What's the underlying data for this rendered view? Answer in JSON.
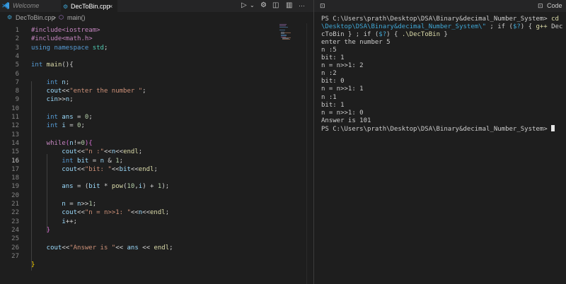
{
  "tabs": {
    "welcome": "Welcome",
    "active": "DecToBin.cpp",
    "close_symbol": "×"
  },
  "breadcrumb": {
    "file": "DecToBin.cpp",
    "separator": ">",
    "function": "main()"
  },
  "terminal_tab": {
    "label": "Code"
  },
  "editor": {
    "line_numbers": [
      "1",
      "2",
      "3",
      "4",
      "5",
      "6",
      "7",
      "8",
      "9",
      "10",
      "11",
      "12",
      "13",
      "14",
      "15",
      "16",
      "17",
      "18",
      "19",
      "20",
      "21",
      "22",
      "23",
      "24",
      "25",
      "26",
      "27"
    ],
    "active_line": 16,
    "lines": [
      [
        {
          "t": "#include<iostream>",
          "c": "#c586c0"
        }
      ],
      [
        {
          "t": "#include<math.h>",
          "c": "#c586c0"
        }
      ],
      [
        {
          "t": "using",
          "c": "#569cd6"
        },
        {
          "t": " namespace ",
          "c": "#569cd6"
        },
        {
          "t": "std",
          "c": "#4ec9b0"
        },
        {
          "t": ";",
          "c": "#d4d4d4"
        }
      ],
      [],
      [
        {
          "t": "int",
          "c": "#569cd6"
        },
        {
          "t": " main",
          "c": "#dcdcaa"
        },
        {
          "t": "(){",
          "c": "#d4d4d4"
        }
      ],
      [],
      [
        {
          "t": "    int",
          "c": "#569cd6"
        },
        {
          "t": " n",
          "c": "#9cdcfe"
        },
        {
          "t": ";",
          "c": "#d4d4d4"
        }
      ],
      [
        {
          "t": "    cout",
          "c": "#9cdcfe"
        },
        {
          "t": "<<",
          "c": "#d4d4d4"
        },
        {
          "t": "\"enter the number \"",
          "c": "#ce9178"
        },
        {
          "t": ";",
          "c": "#d4d4d4"
        }
      ],
      [
        {
          "t": "    cin",
          "c": "#9cdcfe"
        },
        {
          "t": ">>",
          "c": "#d4d4d4"
        },
        {
          "t": "n",
          "c": "#9cdcfe"
        },
        {
          "t": ";",
          "c": "#d4d4d4"
        }
      ],
      [],
      [
        {
          "t": "    int",
          "c": "#569cd6"
        },
        {
          "t": " ans",
          "c": "#9cdcfe"
        },
        {
          "t": " = ",
          "c": "#d4d4d4"
        },
        {
          "t": "0",
          "c": "#b5cea8"
        },
        {
          "t": ";",
          "c": "#d4d4d4"
        }
      ],
      [
        {
          "t": "    int",
          "c": "#569cd6"
        },
        {
          "t": " i",
          "c": "#9cdcfe"
        },
        {
          "t": " = ",
          "c": "#d4d4d4"
        },
        {
          "t": "0",
          "c": "#b5cea8"
        },
        {
          "t": ";",
          "c": "#d4d4d4"
        }
      ],
      [],
      [
        {
          "t": "    while",
          "c": "#c586c0"
        },
        {
          "t": "(",
          "c": "#da70d6"
        },
        {
          "t": "n",
          "c": "#9cdcfe"
        },
        {
          "t": "!=",
          "c": "#d4d4d4"
        },
        {
          "t": "0",
          "c": "#b5cea8"
        },
        {
          "t": "){",
          "c": "#da70d6"
        }
      ],
      [
        {
          "t": "        cout",
          "c": "#9cdcfe"
        },
        {
          "t": "<<",
          "c": "#d4d4d4"
        },
        {
          "t": "\"n :\"",
          "c": "#ce9178"
        },
        {
          "t": "<<",
          "c": "#d4d4d4"
        },
        {
          "t": "n",
          "c": "#9cdcfe"
        },
        {
          "t": "<<",
          "c": "#d4d4d4"
        },
        {
          "t": "endl",
          "c": "#dcdcaa"
        },
        {
          "t": ";",
          "c": "#d4d4d4"
        }
      ],
      [
        {
          "t": "        int",
          "c": "#569cd6"
        },
        {
          "t": " bit",
          "c": "#9cdcfe"
        },
        {
          "t": " = ",
          "c": "#d4d4d4"
        },
        {
          "t": "n",
          "c": "#9cdcfe"
        },
        {
          "t": " & ",
          "c": "#d4d4d4"
        },
        {
          "t": "1",
          "c": "#b5cea8"
        },
        {
          "t": ";",
          "c": "#d4d4d4"
        }
      ],
      [
        {
          "t": "        cout",
          "c": "#9cdcfe"
        },
        {
          "t": "<<",
          "c": "#d4d4d4"
        },
        {
          "t": "\"bit: \"",
          "c": "#ce9178"
        },
        {
          "t": "<<",
          "c": "#d4d4d4"
        },
        {
          "t": "bit",
          "c": "#9cdcfe"
        },
        {
          "t": "<<",
          "c": "#d4d4d4"
        },
        {
          "t": "endl",
          "c": "#dcdcaa"
        },
        {
          "t": ";",
          "c": "#d4d4d4"
        }
      ],
      [],
      [
        {
          "t": "        ans",
          "c": "#9cdcfe"
        },
        {
          "t": " = (",
          "c": "#d4d4d4"
        },
        {
          "t": "bit",
          "c": "#9cdcfe"
        },
        {
          "t": " * ",
          "c": "#d4d4d4"
        },
        {
          "t": "pow",
          "c": "#dcdcaa"
        },
        {
          "t": "(",
          "c": "#d4d4d4"
        },
        {
          "t": "10",
          "c": "#b5cea8"
        },
        {
          "t": ",",
          "c": "#d4d4d4"
        },
        {
          "t": "i",
          "c": "#9cdcfe"
        },
        {
          "t": ") + ",
          "c": "#d4d4d4"
        },
        {
          "t": "1",
          "c": "#b5cea8"
        },
        {
          "t": ");",
          "c": "#d4d4d4"
        }
      ],
      [],
      [
        {
          "t": "        n",
          "c": "#9cdcfe"
        },
        {
          "t": " = ",
          "c": "#d4d4d4"
        },
        {
          "t": "n",
          "c": "#9cdcfe"
        },
        {
          "t": ">>",
          "c": "#d4d4d4"
        },
        {
          "t": "1",
          "c": "#b5cea8"
        },
        {
          "t": ";",
          "c": "#d4d4d4"
        }
      ],
      [
        {
          "t": "        cout",
          "c": "#9cdcfe"
        },
        {
          "t": "<<",
          "c": "#d4d4d4"
        },
        {
          "t": "\"n = n>>1: \"",
          "c": "#ce9178"
        },
        {
          "t": "<<",
          "c": "#d4d4d4"
        },
        {
          "t": "n",
          "c": "#9cdcfe"
        },
        {
          "t": "<<",
          "c": "#d4d4d4"
        },
        {
          "t": "endl",
          "c": "#dcdcaa"
        },
        {
          "t": ";",
          "c": "#d4d4d4"
        }
      ],
      [
        {
          "t": "        i",
          "c": "#9cdcfe"
        },
        {
          "t": "++;",
          "c": "#d4d4d4"
        }
      ],
      [
        {
          "t": "    }",
          "c": "#da70d6"
        }
      ],
      [],
      [
        {
          "t": "    cout",
          "c": "#9cdcfe"
        },
        {
          "t": "<<",
          "c": "#d4d4d4"
        },
        {
          "t": "\"Answer is \"",
          "c": "#ce9178"
        },
        {
          "t": "<< ",
          "c": "#d4d4d4"
        },
        {
          "t": "ans",
          "c": "#9cdcfe"
        },
        {
          "t": " << ",
          "c": "#d4d4d4"
        },
        {
          "t": "endl",
          "c": "#dcdcaa"
        },
        {
          "t": ";",
          "c": "#d4d4d4"
        }
      ],
      [],
      [
        {
          "t": "}",
          "c": "#ffd700"
        }
      ]
    ]
  },
  "terminal": {
    "lines": [
      [
        {
          "t": "PS C:\\Users\\prath\\Desktop\\DSA\\Binary&decimal_Number_System> ",
          "c": "#cccccc"
        },
        {
          "t": "cd",
          "c": "#dcdcaa"
        }
      ],
      [
        {
          "t": "\\Desktop\\DSA\\Binary&decimal_Number_System\\\"",
          "c": "#3fa7d6"
        },
        {
          "t": " ; if (",
          "c": "#cccccc"
        },
        {
          "t": "$?",
          "c": "#3fa7d6"
        },
        {
          "t": ") { ",
          "c": "#cccccc"
        },
        {
          "t": "g++",
          "c": "#dcdcaa"
        },
        {
          "t": " Dec",
          "c": "#cccccc"
        }
      ],
      [
        {
          "t": "cToBin",
          "c": "#cccccc"
        },
        {
          "t": " } ; if (",
          "c": "#cccccc"
        },
        {
          "t": "$?",
          "c": "#3fa7d6"
        },
        {
          "t": ") { ",
          "c": "#cccccc"
        },
        {
          "t": ".\\DecToBin",
          "c": "#dcdcaa"
        },
        {
          "t": " }",
          "c": "#cccccc"
        }
      ],
      [
        {
          "t": "enter the number 5",
          "c": "#cccccc"
        }
      ],
      [
        {
          "t": "n :5",
          "c": "#cccccc"
        }
      ],
      [
        {
          "t": "bit: 1",
          "c": "#cccccc"
        }
      ],
      [
        {
          "t": "n = n>>1: 2",
          "c": "#cccccc"
        }
      ],
      [
        {
          "t": "n :2",
          "c": "#cccccc"
        }
      ],
      [
        {
          "t": "bit: 0",
          "c": "#cccccc"
        }
      ],
      [
        {
          "t": "n = n>>1: 1",
          "c": "#cccccc"
        }
      ],
      [
        {
          "t": "n :1",
          "c": "#cccccc"
        }
      ],
      [
        {
          "t": "bit: 1",
          "c": "#cccccc"
        }
      ],
      [
        {
          "t": "n = n>>1: 0",
          "c": "#cccccc"
        }
      ],
      [
        {
          "t": "Answer is 101",
          "c": "#cccccc"
        }
      ],
      [
        {
          "t": "PS C:\\Users\\prath\\Desktop\\DSA\\Binary&decimal_Number_System> ",
          "c": "#cccccc"
        }
      ]
    ]
  },
  "icons": {
    "run": "▷",
    "run_caret": "⌄",
    "settings": "⚙",
    "split": "◫",
    "layout": "▥",
    "more": "···",
    "terminal": "⊡",
    "gear": "⚙",
    "cube": "⬡"
  }
}
